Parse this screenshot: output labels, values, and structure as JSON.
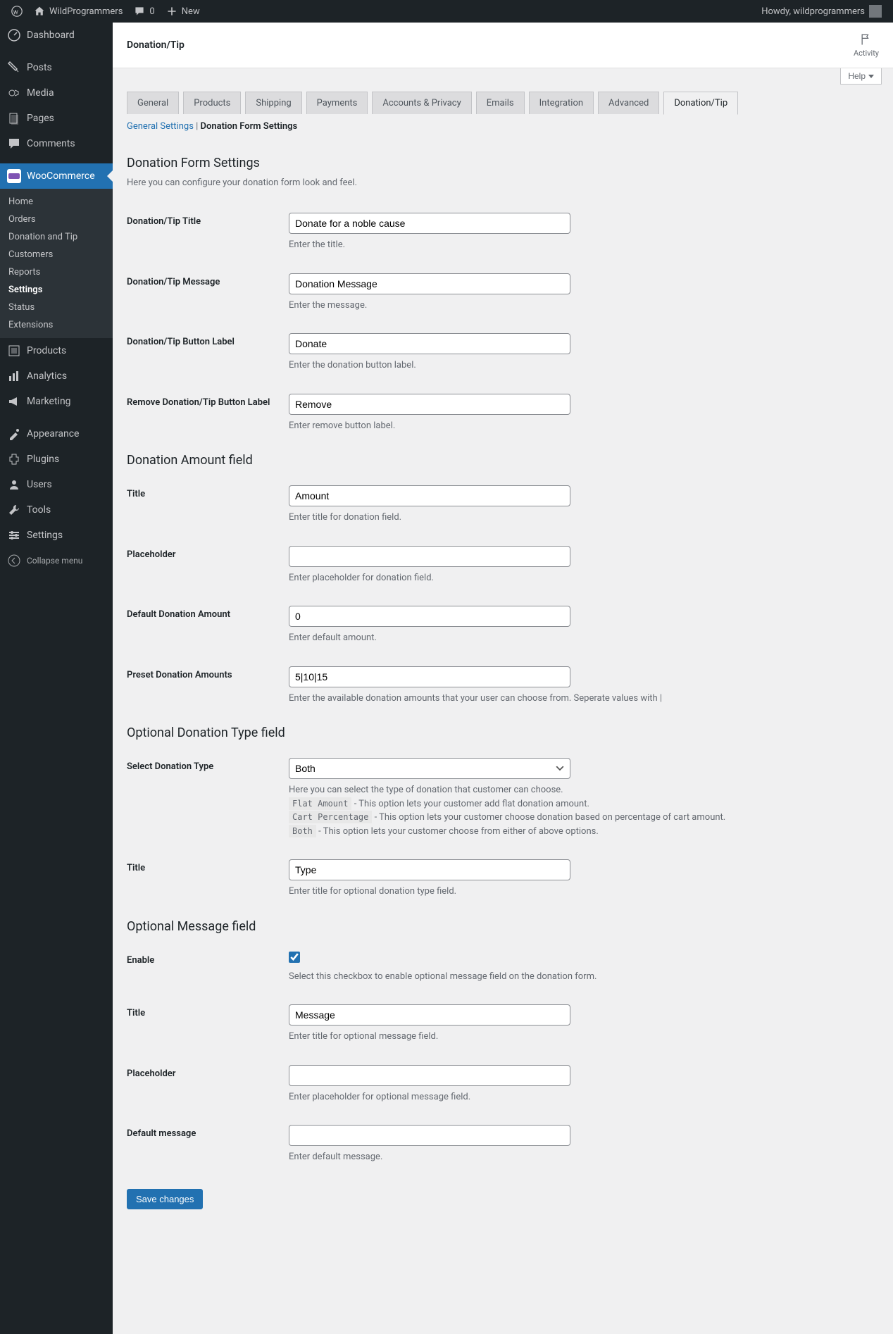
{
  "adminbar": {
    "site": "WildProgrammers",
    "comments": "0",
    "new": "New",
    "howdy": "Howdy, wildprogrammers"
  },
  "sidebar": {
    "items": [
      {
        "label": "Dashboard"
      },
      {
        "label": "Posts"
      },
      {
        "label": "Media"
      },
      {
        "label": "Pages"
      },
      {
        "label": "Comments"
      },
      {
        "label": "WooCommerce"
      },
      {
        "label": "Products"
      },
      {
        "label": "Analytics"
      },
      {
        "label": "Marketing"
      },
      {
        "label": "Appearance"
      },
      {
        "label": "Plugins"
      },
      {
        "label": "Users"
      },
      {
        "label": "Tools"
      },
      {
        "label": "Settings"
      },
      {
        "label": "Collapse menu"
      }
    ],
    "submenu": [
      {
        "label": "Home"
      },
      {
        "label": "Orders"
      },
      {
        "label": "Donation and Tip"
      },
      {
        "label": "Customers"
      },
      {
        "label": "Reports"
      },
      {
        "label": "Settings"
      },
      {
        "label": "Status"
      },
      {
        "label": "Extensions"
      }
    ]
  },
  "header": {
    "title": "Donation/Tip",
    "activity": "Activity",
    "help": "Help"
  },
  "tabs": [
    "General",
    "Products",
    "Shipping",
    "Payments",
    "Accounts & Privacy",
    "Emails",
    "Integration",
    "Advanced",
    "Donation/Tip"
  ],
  "subnav": {
    "general": "General Settings",
    "current": "Donation Form Settings"
  },
  "sections": {
    "s1": {
      "title": "Donation Form Settings",
      "desc": "Here you can configure your donation form look and feel."
    },
    "s2": {
      "title": "Donation Amount field"
    },
    "s3": {
      "title": "Optional Donation Type field"
    },
    "s4": {
      "title": "Optional Message field"
    }
  },
  "fields": {
    "title": {
      "label": "Donation/Tip Title",
      "value": "Donate for a noble cause",
      "help": "Enter the title."
    },
    "message": {
      "label": "Donation/Tip Message",
      "value": "Donation Message",
      "help": "Enter the message."
    },
    "btnlabel": {
      "label": "Donation/Tip Button Label",
      "value": "Donate",
      "help": "Enter the donation button label."
    },
    "removebtn": {
      "label": "Remove Donation/Tip Button Label",
      "value": "Remove",
      "help": "Enter remove button label."
    },
    "amt_title": {
      "label": "Title",
      "value": "Amount",
      "help": "Enter title for donation field."
    },
    "amt_ph": {
      "label": "Placeholder",
      "value": "",
      "help": "Enter placeholder for donation field."
    },
    "amt_default": {
      "label": "Default Donation Amount",
      "value": "0",
      "help": "Enter default amount."
    },
    "preset": {
      "label": "Preset Donation Amounts",
      "value": "5|10|15",
      "help": "Enter the available donation amounts that your user can choose from. Seperate values with |"
    },
    "dtype": {
      "label": "Select Donation Type",
      "value": "Both",
      "help_intro": "Here you can select the type of donation that customer can choose.",
      "opt1_code": "Flat Amount",
      "opt1_text": " - This option lets your customer add flat donation amount.",
      "opt2_code": "Cart Percentage",
      "opt2_text": " - This option lets your customer choose donation based on percentage of cart amount.",
      "opt3_code": "Both",
      "opt3_text": " - This option lets your customer choose from either of above options."
    },
    "dtype_title": {
      "label": "Title",
      "value": "Type",
      "help": "Enter title for optional donation type field."
    },
    "msg_enable": {
      "label": "Enable",
      "help": "Select this checkbox to enable optional message field on the donation form."
    },
    "msg_title": {
      "label": "Title",
      "value": "Message",
      "help": "Enter title for optional message field."
    },
    "msg_ph": {
      "label": "Placeholder",
      "value": "",
      "help": "Enter placeholder for optional message field."
    },
    "msg_default": {
      "label": "Default message",
      "value": "",
      "help": "Enter default message."
    }
  },
  "save": "Save changes"
}
